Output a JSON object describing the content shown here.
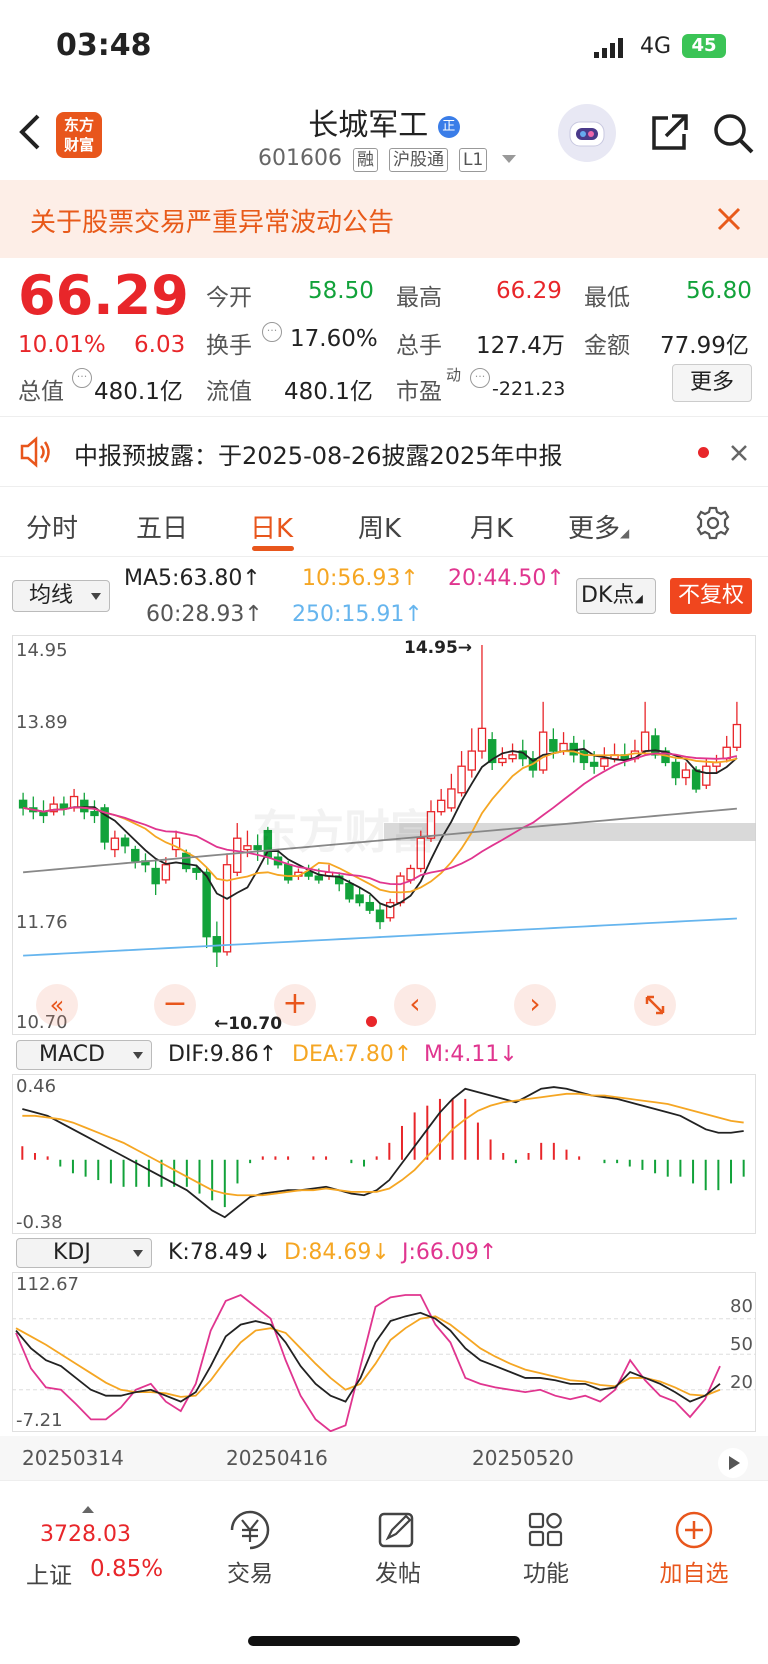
{
  "status": {
    "time": "03:48",
    "network": "4G",
    "battery": "45"
  },
  "header": {
    "logo_line1": "东方",
    "logo_line2": "财富",
    "stock_name": "长城军工",
    "name_badge": "正",
    "stock_code": "601606",
    "tags": [
      "融",
      "沪股通",
      "L1"
    ]
  },
  "announcement": {
    "text": "关于股票交易严重异常波动公告"
  },
  "quote": {
    "price": "66.29",
    "change_pct": "10.01%",
    "change": "6.03",
    "open_label": "今开",
    "open": "58.50",
    "high_label": "最高",
    "high": "66.29",
    "low_label": "最低",
    "low": "56.80",
    "turnover_label": "换手",
    "turnover": "17.60%",
    "volume_label": "总手",
    "volume": "127.4万",
    "amount_label": "金额",
    "amount": "77.99亿",
    "mktcap_label": "总值",
    "mktcap": "480.1亿",
    "float_label": "流值",
    "float_cap": "480.1亿",
    "pe_label": "市盈",
    "pe_sup": "动",
    "pe": "-221.23",
    "more_button": "更多"
  },
  "notice": {
    "text": "中报预披露：于2025-08-26披露2025年中报"
  },
  "tabs": {
    "items": [
      "分时",
      "五日",
      "日K",
      "周K",
      "月K",
      "更多"
    ]
  },
  "ma": {
    "select": "均线",
    "ma5": "MA5:63.80↑",
    "ma10": "10:56.93↑",
    "ma20": "20:44.50↑",
    "ma60": "60:28.93↑",
    "ma250": "250:15.91↑",
    "dk_button": "DK点",
    "adjust_button": "不复权"
  },
  "colors": {
    "up": "#e8262a",
    "down": "#12a23a",
    "accent": "#e8561c",
    "ma10": "#f5a623",
    "ma20": "#e0358f",
    "ma250": "#66b5ee"
  },
  "chart_data": [
    {
      "type": "candlestick",
      "title": "日K",
      "y_ticks": [
        "14.95",
        "13.89",
        "11.76",
        "10.70"
      ],
      "ylim": [
        10.7,
        14.95
      ],
      "annotations": [
        "14.95→",
        "←10.70"
      ],
      "x_ticks": [
        "20250314",
        "20250416",
        "20250520"
      ],
      "series_names": [
        "MA5",
        "MA10",
        "MA20",
        "MA60",
        "MA250"
      ],
      "candles": [
        [
          12.9,
          12.8,
          13.0,
          12.7
        ],
        [
          12.8,
          12.75,
          12.95,
          12.65
        ],
        [
          12.75,
          12.7,
          12.9,
          12.6
        ],
        [
          12.75,
          12.85,
          12.95,
          12.7
        ],
        [
          12.85,
          12.8,
          12.95,
          12.7
        ],
        [
          12.8,
          12.95,
          13.05,
          12.75
        ],
        [
          12.9,
          12.75,
          13.0,
          12.65
        ],
        [
          12.75,
          12.7,
          12.9,
          12.6
        ],
        [
          12.8,
          12.35,
          12.85,
          12.25
        ],
        [
          12.25,
          12.4,
          12.5,
          12.15
        ],
        [
          12.4,
          12.3,
          12.45,
          12.2
        ],
        [
          12.25,
          12.1,
          12.3,
          12.0
        ],
        [
          12.1,
          12.05,
          12.2,
          11.95
        ],
        [
          12.0,
          11.8,
          12.1,
          11.65
        ],
        [
          11.85,
          12.05,
          12.15,
          11.8
        ],
        [
          12.25,
          12.4,
          12.5,
          12.15
        ],
        [
          12.2,
          12.0,
          12.25,
          11.95
        ],
        [
          12.0,
          11.95,
          12.05,
          11.85
        ],
        [
          11.95,
          11.1,
          12.0,
          10.95
        ],
        [
          11.1,
          10.9,
          11.3,
          10.7
        ],
        [
          10.9,
          12.05,
          12.2,
          10.85
        ],
        [
          11.95,
          12.4,
          12.6,
          11.9
        ],
        [
          12.25,
          12.3,
          12.5,
          12.15
        ],
        [
          12.3,
          12.25,
          12.45,
          12.1
        ],
        [
          12.5,
          12.15,
          12.55,
          12.05
        ],
        [
          12.15,
          12.05,
          12.25,
          12.0
        ],
        [
          12.05,
          11.85,
          12.1,
          11.8
        ],
        [
          11.9,
          11.95,
          12.0,
          11.85
        ],
        [
          11.95,
          11.9,
          12.05,
          11.85
        ],
        [
          11.9,
          11.85,
          12.0,
          11.8
        ],
        [
          11.9,
          11.95,
          12.05,
          11.85
        ],
        [
          11.9,
          11.8,
          11.95,
          11.7
        ],
        [
          11.8,
          11.6,
          11.85,
          11.55
        ],
        [
          11.65,
          11.55,
          11.75,
          11.5
        ],
        [
          11.55,
          11.45,
          11.65,
          11.4
        ],
        [
          11.45,
          11.3,
          11.55,
          11.2
        ],
        [
          11.35,
          11.55,
          11.6,
          11.3
        ],
        [
          11.55,
          11.9,
          11.95,
          11.5
        ],
        [
          11.85,
          12.0,
          12.05,
          11.8
        ],
        [
          12.0,
          12.4,
          12.5,
          11.95
        ],
        [
          12.4,
          12.75,
          12.9,
          12.35
        ],
        [
          12.75,
          12.9,
          13.05,
          12.7
        ],
        [
          12.8,
          13.05,
          13.25,
          12.75
        ],
        [
          13.0,
          13.35,
          13.55,
          12.95
        ],
        [
          13.3,
          13.55,
          13.85,
          13.2
        ],
        [
          13.55,
          13.85,
          14.95,
          13.45
        ],
        [
          13.7,
          13.4,
          13.8,
          13.3
        ],
        [
          13.4,
          13.45,
          13.6,
          13.35
        ],
        [
          13.45,
          13.5,
          13.65,
          13.4
        ],
        [
          13.55,
          13.45,
          13.7,
          13.35
        ],
        [
          13.45,
          13.3,
          13.55,
          13.2
        ],
        [
          13.3,
          13.8,
          14.2,
          13.25
        ],
        [
          13.7,
          13.55,
          13.85,
          13.45
        ],
        [
          13.55,
          13.65,
          13.8,
          13.5
        ],
        [
          13.65,
          13.5,
          13.75,
          13.4
        ],
        [
          13.55,
          13.4,
          13.7,
          13.3
        ],
        [
          13.4,
          13.35,
          13.55,
          13.25
        ],
        [
          13.35,
          13.45,
          13.6,
          13.3
        ],
        [
          13.45,
          13.5,
          13.65,
          13.4
        ],
        [
          13.5,
          13.45,
          13.65,
          13.35
        ],
        [
          13.45,
          13.55,
          13.7,
          13.4
        ],
        [
          13.55,
          13.8,
          14.2,
          13.5
        ],
        [
          13.75,
          13.5,
          13.85,
          13.45
        ],
        [
          13.55,
          13.4,
          13.6,
          13.35
        ],
        [
          13.4,
          13.2,
          13.45,
          13.1
        ],
        [
          13.2,
          13.3,
          13.4,
          13.1
        ],
        [
          13.3,
          13.05,
          13.35,
          13.0
        ],
        [
          13.1,
          13.35,
          13.45,
          13.05
        ],
        [
          13.35,
          13.4,
          13.5,
          13.25
        ],
        [
          13.45,
          13.6,
          13.75,
          13.4
        ],
        [
          13.6,
          13.9,
          14.2,
          13.55
        ]
      ]
    },
    {
      "type": "macd",
      "select": "MACD",
      "dif_label": "DIF:9.86↑",
      "dea_label": "DEA:7.80↑",
      "m_label": "M:4.11↓",
      "y_ticks": [
        "0.46",
        "-0.38"
      ],
      "ylim": [
        -0.38,
        0.46
      ],
      "dif": [
        0.3,
        0.28,
        0.26,
        0.22,
        0.18,
        0.14,
        0.1,
        0.06,
        0.02,
        -0.02,
        -0.06,
        -0.1,
        -0.14,
        -0.18,
        -0.24,
        -0.3,
        -0.34,
        -0.28,
        -0.22,
        -0.2,
        -0.19,
        -0.18,
        -0.18,
        -0.17,
        -0.16,
        -0.18,
        -0.2,
        -0.21,
        -0.18,
        -0.12,
        -0.02,
        0.08,
        0.18,
        0.28,
        0.36,
        0.42,
        0.4,
        0.38,
        0.36,
        0.34,
        0.38,
        0.42,
        0.43,
        0.42,
        0.4,
        0.38,
        0.37,
        0.36,
        0.34,
        0.32,
        0.3,
        0.28,
        0.26,
        0.22,
        0.18,
        0.16,
        0.16,
        0.17
      ],
      "dea": [
        0.26,
        0.26,
        0.25,
        0.24,
        0.22,
        0.19,
        0.16,
        0.13,
        0.1,
        0.06,
        0.02,
        -0.02,
        -0.06,
        -0.1,
        -0.14,
        -0.18,
        -0.2,
        -0.21,
        -0.21,
        -0.21,
        -0.2,
        -0.19,
        -0.18,
        -0.18,
        -0.17,
        -0.18,
        -0.19,
        -0.19,
        -0.19,
        -0.17,
        -0.12,
        -0.06,
        0.02,
        0.1,
        0.18,
        0.24,
        0.29,
        0.32,
        0.34,
        0.35,
        0.36,
        0.37,
        0.38,
        0.39,
        0.39,
        0.38,
        0.38,
        0.37,
        0.36,
        0.35,
        0.34,
        0.33,
        0.31,
        0.29,
        0.27,
        0.25,
        0.23,
        0.22
      ]
    },
    {
      "type": "kdj",
      "select": "KDJ",
      "k_label": "K:78.49↓",
      "d_label": "D:84.69↓",
      "j_label": "J:66.09↑",
      "y_ticks": [
        "112.67",
        "-7.21"
      ],
      "right_ticks": [
        "80",
        "50",
        "20"
      ],
      "ylim": [
        -7.21,
        112.67
      ],
      "k": [
        70,
        55,
        45,
        40,
        30,
        20,
        15,
        15,
        18,
        20,
        15,
        10,
        18,
        40,
        65,
        75,
        78,
        75,
        60,
        40,
        25,
        15,
        10,
        30,
        60,
        78,
        82,
        85,
        80,
        70,
        55,
        45,
        40,
        35,
        30,
        30,
        28,
        25,
        25,
        20,
        22,
        35,
        30,
        25,
        18,
        10,
        15,
        25
      ],
      "d": [
        72,
        65,
        58,
        50,
        42,
        34,
        26,
        20,
        18,
        18,
        17,
        14,
        15,
        28,
        45,
        60,
        70,
        72,
        68,
        55,
        42,
        30,
        20,
        25,
        42,
        62,
        72,
        80,
        82,
        75,
        65,
        55,
        48,
        42,
        37,
        34,
        31,
        28,
        27,
        24,
        23,
        30,
        30,
        27,
        22,
        16,
        15,
        20
      ],
      "j": [
        68,
        38,
        22,
        20,
        8,
        -5,
        -5,
        5,
        20,
        25,
        10,
        2,
        25,
        70,
        95,
        100,
        90,
        80,
        45,
        15,
        -5,
        -15,
        -10,
        40,
        90,
        98,
        100,
        100,
        75,
        60,
        30,
        25,
        22,
        20,
        18,
        20,
        15,
        12,
        15,
        10,
        20,
        45,
        28,
        15,
        10,
        -3,
        12,
        40
      ]
    }
  ],
  "footer": {
    "index_value": "3728.03",
    "index_name": "上证",
    "index_change": "0.85%",
    "trade_label": "交易",
    "post_label": "发帖",
    "func_label": "功能",
    "watch_label": "加自选"
  },
  "watermark": "东方财富"
}
